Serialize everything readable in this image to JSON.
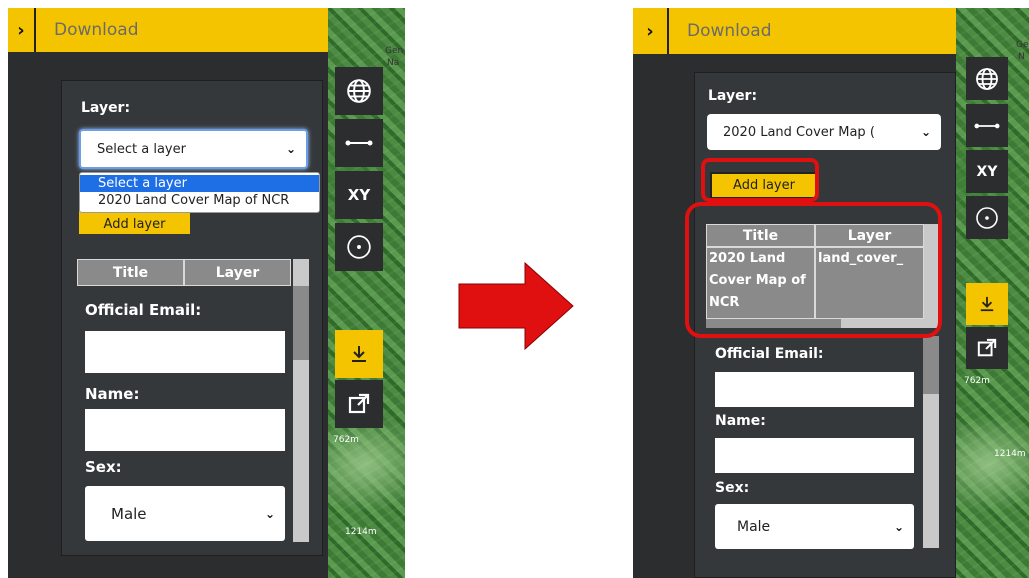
{
  "colors": {
    "accent": "#f5c400",
    "panel": "#2b2d2f",
    "highlight": "#e01010",
    "arrow": "#e01010"
  },
  "before": {
    "header_title": "Download",
    "layer_label": "Layer:",
    "layer_select_value": "Select a layer",
    "dropdown_options": [
      "Select a layer",
      "2020 Land Cover Map of NCR"
    ],
    "add_layer_partial": "Add layer",
    "table_headers": [
      "Title",
      "Layer"
    ],
    "email_label": "Official Email:",
    "name_label": "Name:",
    "sex_label": "Sex:",
    "sex_value": "Male",
    "map_labels": [
      "Gen",
      "Na",
      "762m",
      "1214m",
      "o"
    ]
  },
  "after": {
    "header_title": "Download",
    "layer_label": "Layer:",
    "layer_select_value": "2020 Land Cover Map (",
    "add_layer_label": "Add layer",
    "table_headers": [
      "Title",
      "Layer"
    ],
    "table_rows": [
      {
        "title": "2020 Land Cover Map of NCR",
        "layer": "land_cover_"
      }
    ],
    "email_label": "Official Email:",
    "name_label": "Name:",
    "sex_label": "Sex:",
    "sex_value": "Male",
    "map_labels": [
      "Gen",
      "N",
      "762m",
      "1214m",
      "lo"
    ]
  },
  "icons": [
    "chevron-right-icon",
    "globe-icon",
    "measure-icon",
    "xy-icon",
    "locate-icon",
    "download-icon",
    "open-external-icon",
    "chevron-down-icon"
  ]
}
